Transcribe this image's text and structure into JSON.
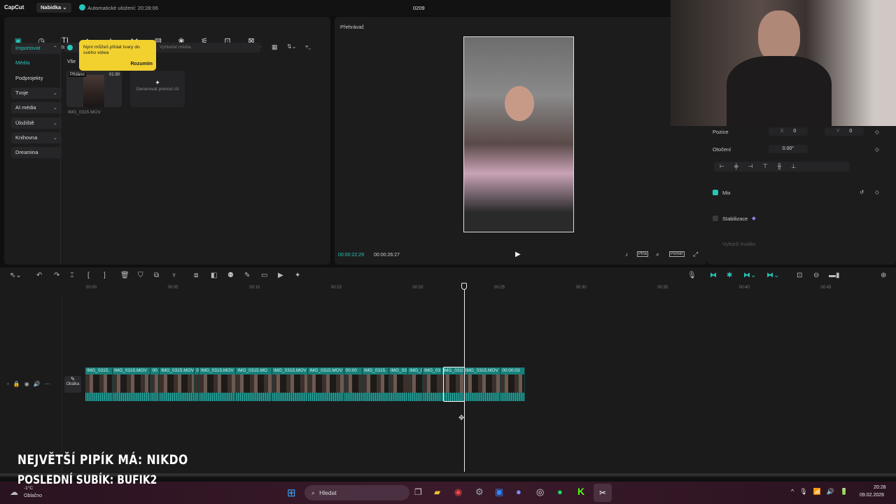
{
  "app": {
    "logo": "CapCut",
    "menu_label": "Nabídka",
    "autosave": "Automatické uložení: 20:28:06",
    "project_name": "0209",
    "accent": "#26c6b8"
  },
  "toolbar": [
    {
      "label": "Média",
      "icon": "media-icon",
      "active": true
    },
    {
      "label": "Zvuk",
      "icon": "audio-icon"
    },
    {
      "label": "Text",
      "icon": "text-icon"
    },
    {
      "label": "Nálepky",
      "icon": "sticker-icon"
    },
    {
      "label": "Efekty",
      "icon": "effects-icon"
    },
    {
      "label": "Přechody",
      "icon": "transitions-icon"
    },
    {
      "label": "Titulky",
      "icon": "captions-icon"
    },
    {
      "label": "Filtry",
      "icon": "filters-icon"
    },
    {
      "label": "Úprava",
      "icon": "adjust-icon"
    },
    {
      "label": "Šablony",
      "icon": "templates-icon"
    },
    {
      "label": "AI avatar",
      "icon": "ai-avatar-icon"
    }
  ],
  "sidebar": [
    {
      "label": "Importovat",
      "box": true,
      "active": true,
      "chev": "^"
    },
    {
      "label": "Média",
      "active": true
    },
    {
      "label": "Podprojekty"
    },
    {
      "label": "Tvoje",
      "box": true,
      "chev": "v"
    },
    {
      "label": "AI média",
      "box": true,
      "chev": "v"
    },
    {
      "label": "Úložiště",
      "box": true,
      "chev": "v"
    },
    {
      "label": "Knihovna",
      "box": true,
      "chev": "v"
    },
    {
      "label": "Dreamina",
      "box": true
    }
  ],
  "media": {
    "search_placeholder": "Vyhledat média",
    "filter_all": "Vše",
    "tooltip_text": "Nyní můžeš přidat tvary do svého videa",
    "tooltip_button": "Rozumím",
    "item": {
      "badge": "Přidáno",
      "duration": "01:30",
      "name": "IMG_0315.MOV"
    },
    "generate_ai": "Generovat pomocí AI"
  },
  "player": {
    "title": "Přehrávač",
    "current_time": "00:00:22:29",
    "total_time": "00:00:26:27",
    "ratio_label": "Poměr"
  },
  "properties": {
    "position_label": "Pozice",
    "x_label": "X",
    "x": "0",
    "y_label": "Y",
    "y": "0",
    "rotation_label": "Otočení",
    "rotation": "0.00°",
    "mix_label": "Mix",
    "mix_checked": true,
    "stabilize_label": "Stabilizace",
    "stabilize_checked": false,
    "enhance_label": "Vylepši kvalitu"
  },
  "timeline": {
    "ruler": [
      "00:00",
      "00:05",
      "00:10",
      "00:15",
      "00:20",
      "00:25",
      "00:30",
      "00:35",
      "00:40",
      "00:45"
    ],
    "cover_label": "Obálka",
    "playhead_time": "00:22",
    "clips": [
      "IMG_0315.",
      "IMG_0315.MOV",
      "00",
      "IMG_0315.MOV",
      "0",
      "IMG_0315.MOV",
      "IMG_0315.MO",
      "IMG_0315.MOV",
      "IMG_0315.MOV",
      "00:00",
      "IMG_0315.",
      "IMG_03",
      "IMG_031",
      "IMG_0315",
      "IMG_0315",
      "IMG_0315.MOV",
      "00:00:03"
    ]
  },
  "overlay": {
    "line1": "NEJVĚTŠÍ PIPÍK MÁ: NIKDO",
    "line2": "POSLEDNÍ SUBÍK: BUFIK2"
  },
  "taskbar": {
    "weather_temp": "-1°C",
    "weather_desc": "Oblačno",
    "search": "Hledat",
    "time": "20:28",
    "date": "09.02.2026"
  }
}
